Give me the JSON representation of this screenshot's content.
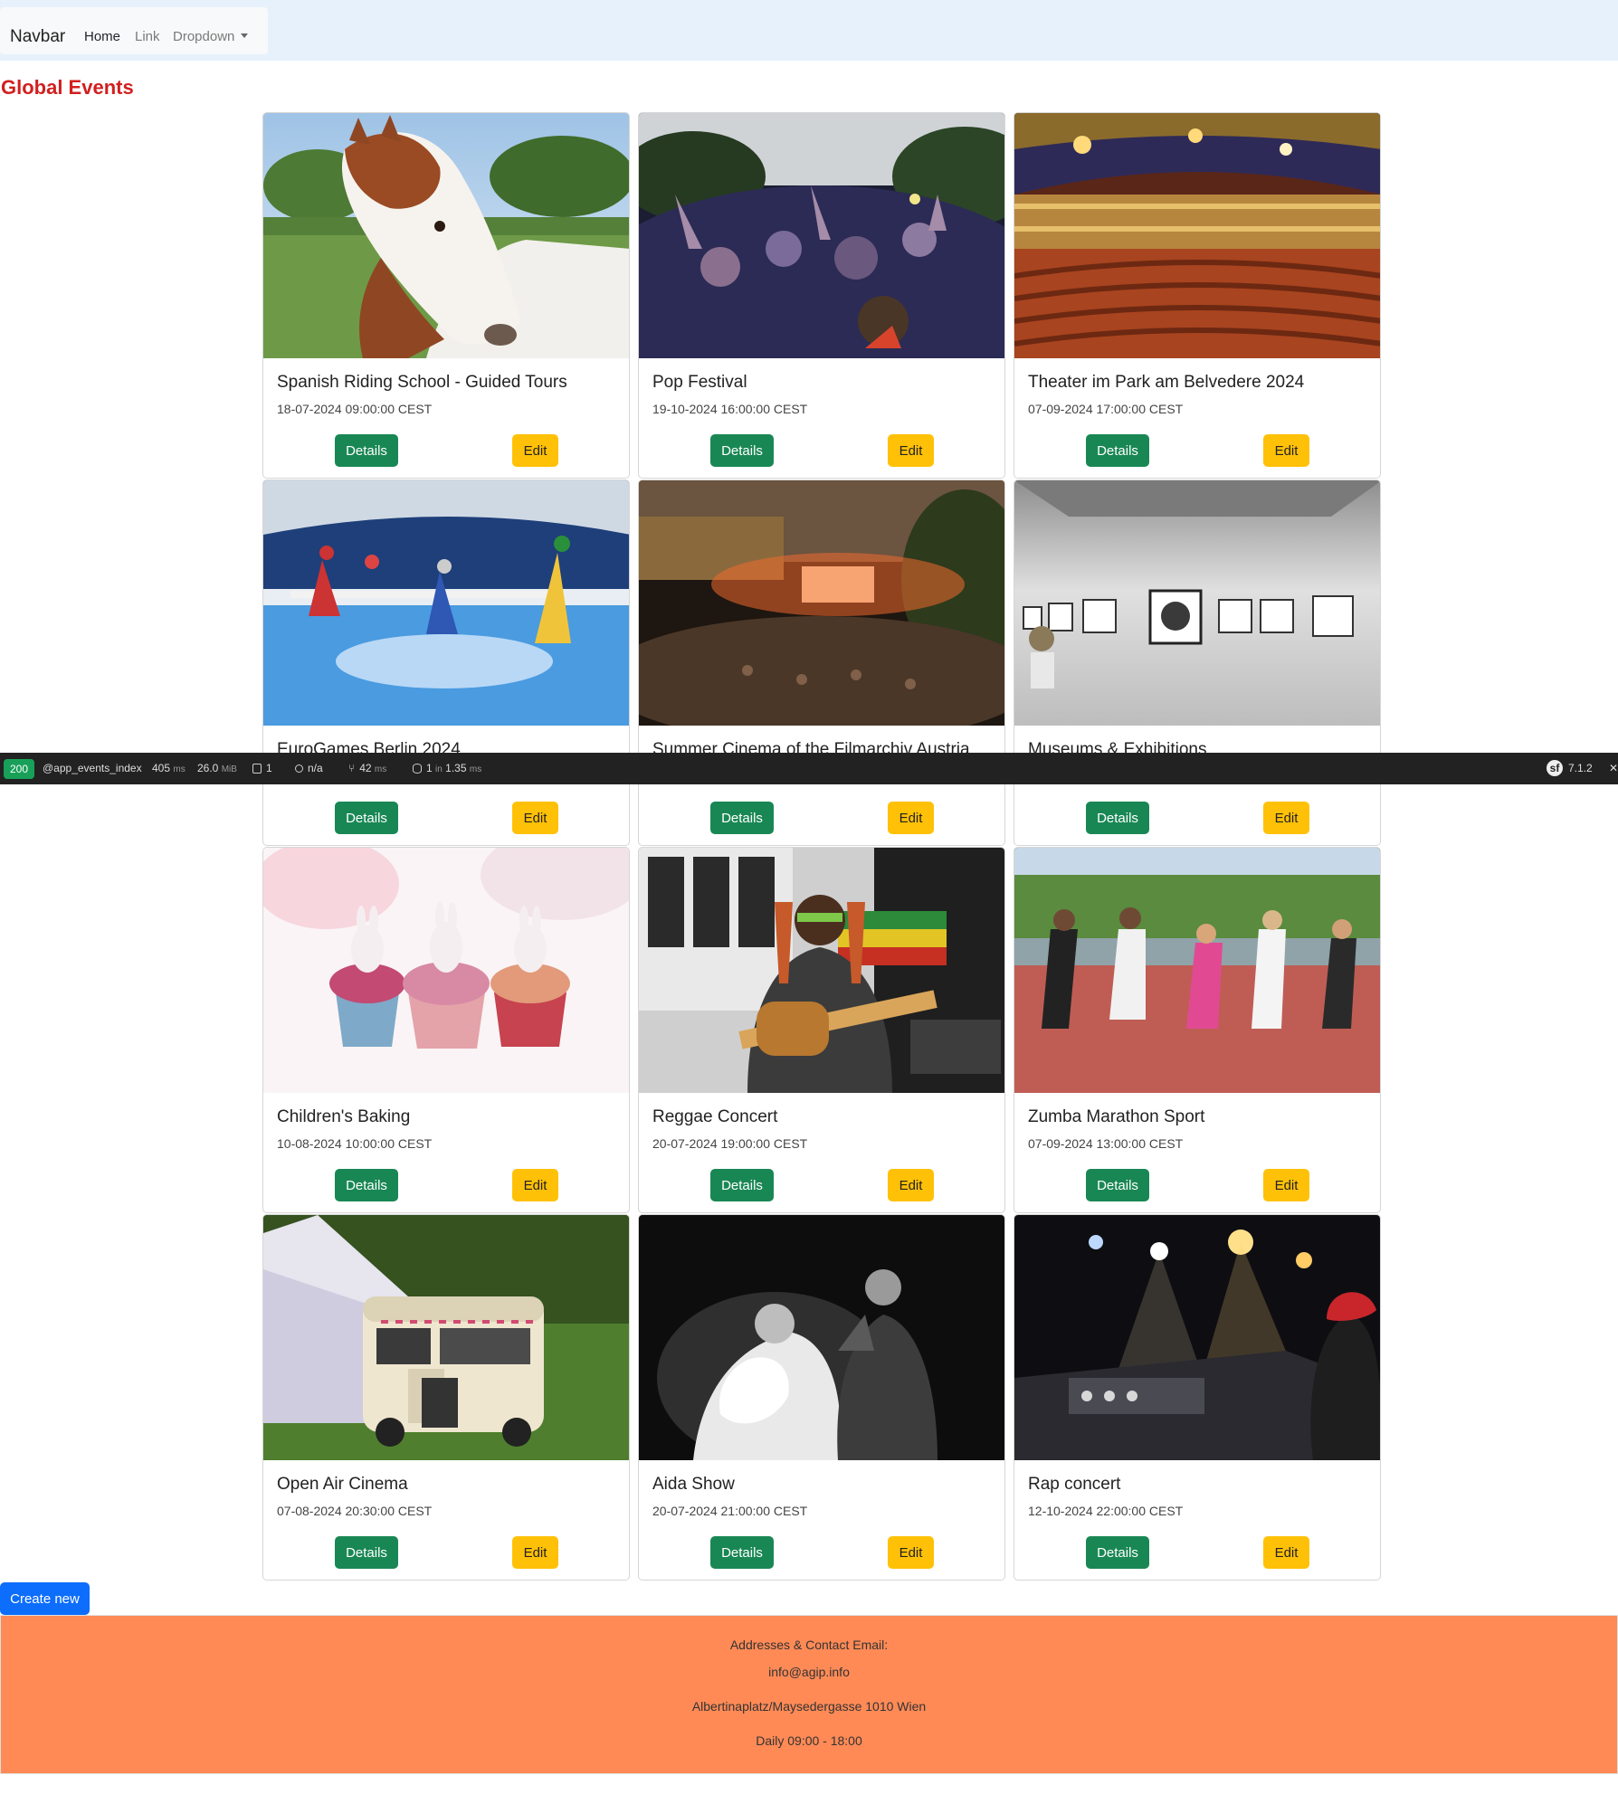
{
  "navbar": {
    "brand": "Navbar",
    "links": [
      {
        "label": "Home",
        "active": true
      },
      {
        "label": "Link",
        "active": false
      },
      {
        "label": "Dropdown",
        "active": false
      }
    ]
  },
  "page": {
    "title": "Global Events"
  },
  "events": [
    {
      "title": "Spanish Riding School - Guided Tours",
      "date": "18-07-2024 09:00:00 CEST",
      "image": "horse",
      "details_label": "Details",
      "edit_label": "Edit"
    },
    {
      "title": "Pop Festival",
      "date": "19-10-2024 16:00:00 CEST",
      "image": "crowd",
      "details_label": "Details",
      "edit_label": "Edit"
    },
    {
      "title": "Theater im Park am Belvedere 2024",
      "date": "07-09-2024 17:00:00 CEST",
      "image": "theater",
      "details_label": "Details",
      "edit_label": "Edit"
    },
    {
      "title": "EuroGames Berlin 2024",
      "date": "",
      "image": "hurdles",
      "details_label": "Details",
      "edit_label": "Edit"
    },
    {
      "title": "Summer Cinema of the Filmarchiv Austria",
      "date": "",
      "image": "cinema",
      "details_label": "Details",
      "edit_label": "Edit"
    },
    {
      "title": "Museums & Exhibitions",
      "date": "",
      "image": "gallery",
      "details_label": "Details",
      "edit_label": "Edit"
    },
    {
      "title": "Children's Baking",
      "date": "10-08-2024 10:00:00 CEST",
      "image": "cupcakes",
      "details_label": "Details",
      "edit_label": "Edit"
    },
    {
      "title": "Reggae Concert",
      "date": "20-07-2024 19:00:00 CEST",
      "image": "guitarist",
      "details_label": "Details",
      "edit_label": "Edit"
    },
    {
      "title": "Zumba Marathon Sport",
      "date": "07-09-2024 13:00:00 CEST",
      "image": "zumba",
      "details_label": "Details",
      "edit_label": "Edit"
    },
    {
      "title": "Open Air Cinema",
      "date": "07-08-2024 20:30:00 CEST",
      "image": "van",
      "details_label": "Details",
      "edit_label": "Edit"
    },
    {
      "title": "Aida Show",
      "date": "20-07-2024 21:00:00 CEST",
      "image": "aida",
      "details_label": "Details",
      "edit_label": "Edit"
    },
    {
      "title": "Rap concert",
      "date": "12-10-2024 22:00:00 CEST",
      "image": "stage",
      "details_label": "Details",
      "edit_label": "Edit"
    }
  ],
  "debug_toolbar": {
    "status": "200",
    "route": "@app_events_index",
    "time": "405",
    "time_unit": "ms",
    "memory": "26.0",
    "memory_unit": "MiB",
    "logs": "1",
    "user": "n/a",
    "render_time": "42",
    "render_unit": "ms",
    "queries": "1",
    "queries_in": "in",
    "queries_time": "1.35",
    "queries_unit": "ms",
    "version": "7.1.2",
    "close": "✕"
  },
  "create_button": "Create new",
  "footer": {
    "heading": "Addresses & Contact Email:",
    "email": "info@agip.info",
    "address": "Albertinaplatz/Maysedergasse 1010 Wien",
    "hours": "Daily 09:00 - 18:00"
  },
  "colors": {
    "title_red": "#d21f1f",
    "details_green": "#198754",
    "edit_yellow": "#ffc107",
    "create_blue": "#0d6efd",
    "footer_orange": "#ff8a56",
    "navbar_bg": "#e7f1fc",
    "debugbar_bg": "#222222"
  }
}
